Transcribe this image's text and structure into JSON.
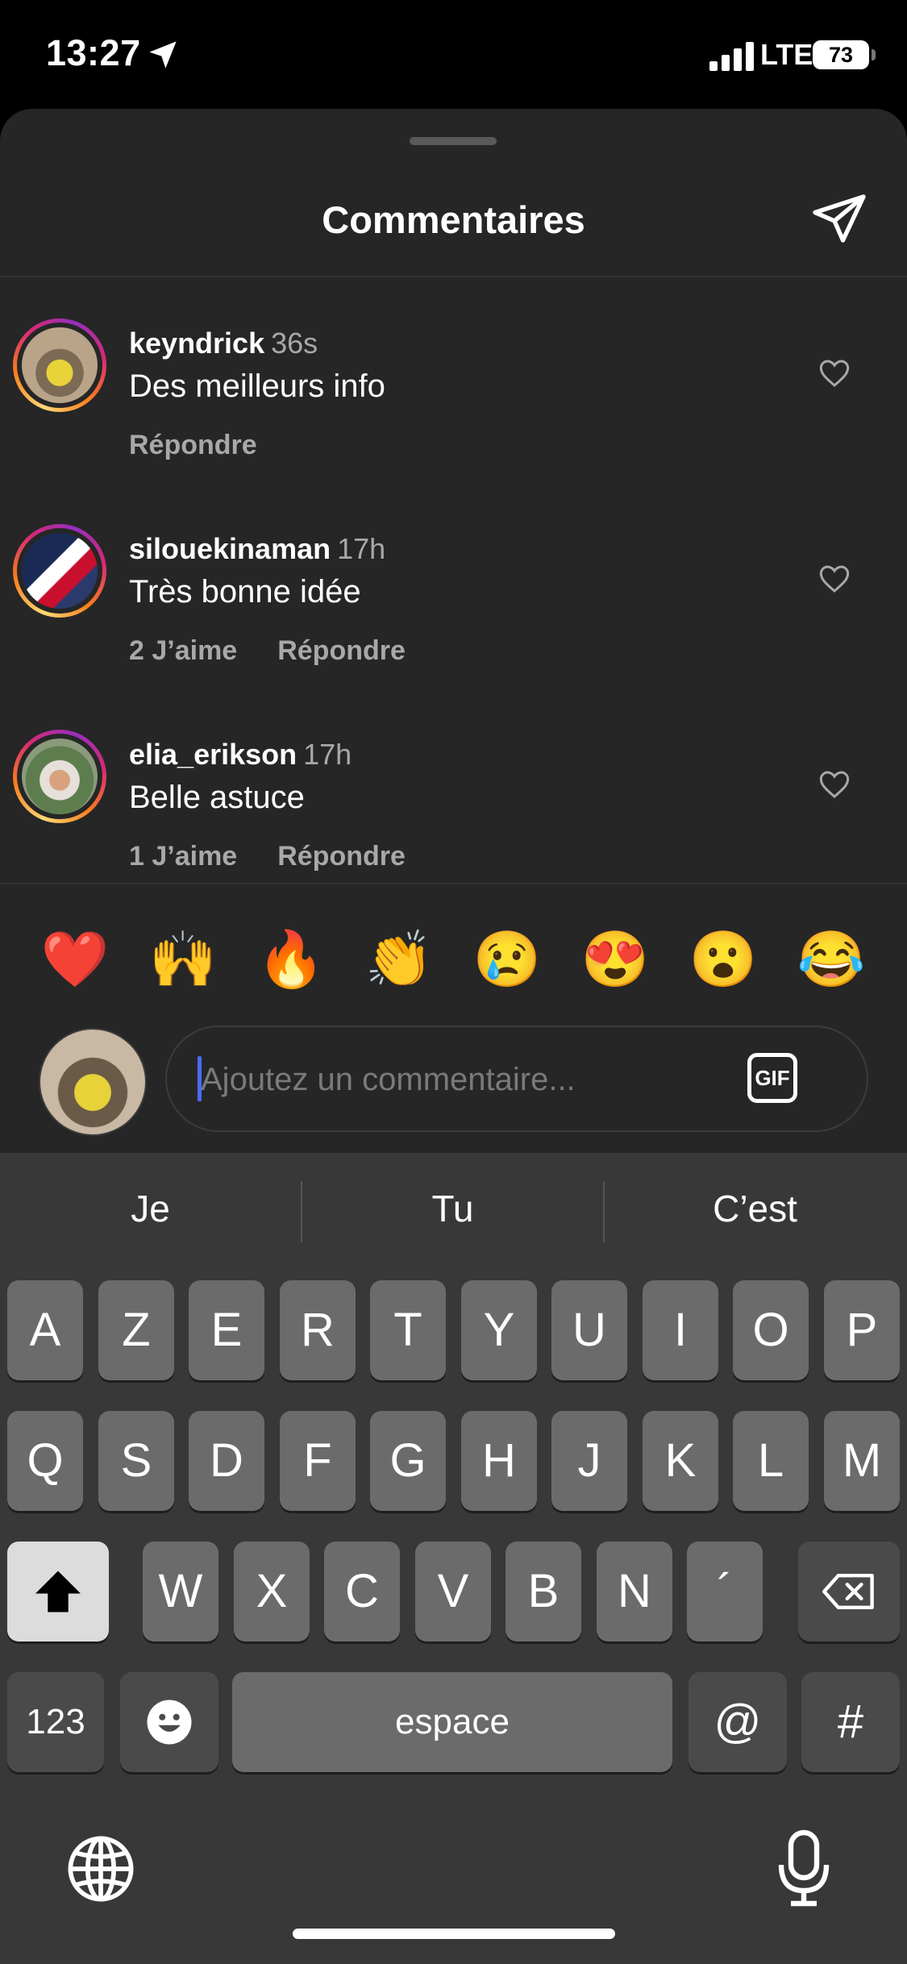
{
  "status": {
    "time": "13:27",
    "network": "LTE",
    "battery": "73"
  },
  "sheet": {
    "title": "Commentaires"
  },
  "comments": [
    {
      "user": "keyndrick",
      "time": "36s",
      "text": "Des meilleurs info",
      "likes": "",
      "reply": "Répondre"
    },
    {
      "user": "silouekinaman",
      "time": "17h",
      "text": "Très bonne idée",
      "likes": "2 J’aime",
      "reply": "Répondre"
    },
    {
      "user": "elia_erikson",
      "time": "17h",
      "text": "Belle astuce",
      "likes": "1 J’aime",
      "reply": "Répondre"
    }
  ],
  "emojis": [
    "❤️",
    "🙌",
    "🔥",
    "👏",
    "😢",
    "😍",
    "😮",
    "😂"
  ],
  "composer": {
    "placeholder": "Ajoutez un commentaire...",
    "gif": "GIF"
  },
  "keyboard": {
    "suggestions": [
      "Je",
      "Tu",
      "C’est"
    ],
    "row1": [
      "A",
      "Z",
      "E",
      "R",
      "T",
      "Y",
      "U",
      "I",
      "O",
      "P"
    ],
    "row2": [
      "Q",
      "S",
      "D",
      "F",
      "G",
      "H",
      "J",
      "K",
      "L",
      "M"
    ],
    "row3": [
      "W",
      "X",
      "C",
      "V",
      "B",
      "N",
      "´"
    ],
    "numbers": "123",
    "space": "espace",
    "at": "@",
    "hash": "#"
  }
}
